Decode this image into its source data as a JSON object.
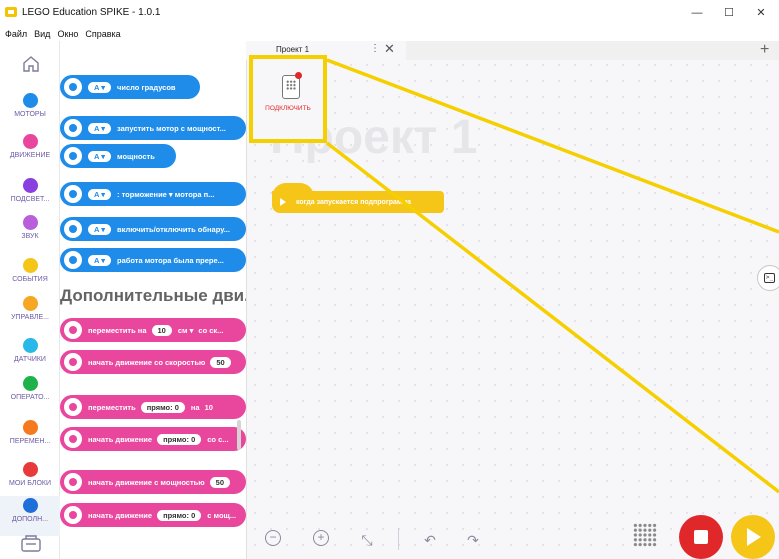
{
  "window": {
    "title": "LEGO Education SPIKE - 1.0.1",
    "minimize": "—",
    "maximize": "☐",
    "close": "✕"
  },
  "menu": [
    "Файл",
    "Вид",
    "Окно",
    "Справка"
  ],
  "categories": [
    {
      "label": "МОТОРЫ",
      "color": "#1e8ce8"
    },
    {
      "label": "ДВИЖЕНИЕ",
      "color": "#e8479d"
    },
    {
      "label": "ПОДСВЕТ...",
      "color": "#8a3fe0"
    },
    {
      "label": "ЗВУК",
      "color": "#b95fdc"
    },
    {
      "label": "СОБЫТИЯ",
      "color": "#f5c518"
    },
    {
      "label": "УПРАВЛЕ...",
      "color": "#f5a623"
    },
    {
      "label": "ДАТЧИКИ",
      "color": "#2ab8e8"
    },
    {
      "label": "ОПЕРАТО...",
      "color": "#1fb24a"
    },
    {
      "label": "ПЕРЕМЕН...",
      "color": "#f57a1f"
    },
    {
      "label": "МОИ БЛОКИ",
      "color": "#e83a3a"
    },
    {
      "label": "ДОПОЛН...",
      "color": "#1e6fd9"
    }
  ],
  "palette": {
    "motor_blocks": [
      {
        "port": "A ▾",
        "text": "число градусов"
      },
      {
        "port": "A ▾",
        "text": "запустить мотор с мощност..."
      },
      {
        "port": "A ▾",
        "text": "мощность"
      },
      {
        "port": "A ▾",
        "text": ":   торможение ▾   мотора п..."
      },
      {
        "port": "A ▾",
        "text": "включить/отключить обнару..."
      },
      {
        "port": "A ▾",
        "text": "работа мотора была прере..."
      }
    ],
    "section_title": "Дополнительные дви...",
    "move_blocks": [
      {
        "pre": "переместить на",
        "val": "10",
        "pill2": "см ▾",
        "post": "со ск..."
      },
      {
        "pre": "начать движение со скоростью",
        "val": "50",
        "pill2": "",
        "post": ""
      },
      {
        "pre": "переместить",
        "val": "прямо: 0",
        "pill2": "на",
        "post": "10"
      },
      {
        "pre": "начать движение",
        "val": "прямо: 0",
        "pill2": "",
        "post": "со с..."
      },
      {
        "pre": "начать движение с мощностью",
        "val": "50",
        "pill2": "",
        "post": ""
      },
      {
        "pre": "начать движение",
        "val": "прямо: 0",
        "pill2": "",
        "post": "с мощ..."
      }
    ]
  },
  "tab": {
    "label": "Проект 1",
    "menu": "⋮",
    "close": "✕",
    "add": "+"
  },
  "canvas": {
    "watermark": "Проект 1",
    "connect_label": "ПОДКЛЮЧИТЬ",
    "hat_block": "когда запускается подпрограмма"
  },
  "toolbar": {
    "zoom_out": "−",
    "zoom_in": "+",
    "recenter": "⤡",
    "undo": "↶",
    "redo": "↷"
  },
  "colors": {
    "highlight": "#f5cf00",
    "motor_blue": "#1e8ce8",
    "move_pink": "#e8479d",
    "event_yellow": "#f5c518",
    "stop_red": "#e0282a"
  }
}
